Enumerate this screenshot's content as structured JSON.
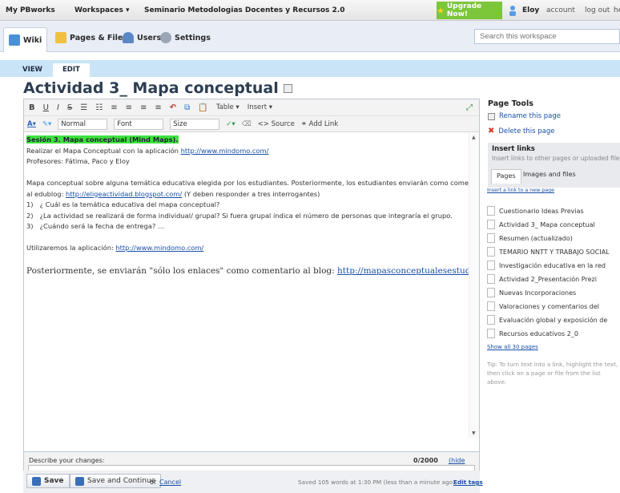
{
  "topbar": {
    "my_pbworks": "My PBworks",
    "workspaces": "Workspaces ▾",
    "workspace_name": "Seminario Metodologias Docentes y Recursos 2.0",
    "upgrade": "Upgrade Now!",
    "user": "Eloy",
    "account": "account",
    "logout": "log out",
    "help": "he"
  },
  "nav": {
    "tabs": [
      {
        "label": "Wiki"
      },
      {
        "label": "Pages & Files"
      },
      {
        "label": "Users"
      },
      {
        "label": "Settings"
      }
    ],
    "search_placeholder": "Search this workspace"
  },
  "subtabs": {
    "view": "VIEW",
    "edit": "EDIT"
  },
  "page_title": "Actividad 3_ Mapa conceptual",
  "toolbar": {
    "table": "Table ▾",
    "insert": "Insert ▾",
    "style": "Normal",
    "font": "Font",
    "size": "Size",
    "source": "Source",
    "add_link": "Add Link"
  },
  "content": {
    "line1": "Sesión 3. Mapa conceptual (Mind Maps).",
    "line2_text": "Realizar el Mapa Conceptual con la aplicación ",
    "line2_link": "http://www.mindomo.com/",
    "line3": "Profesores: Fátima, Paco y Eloy",
    "line4": "Mapa conceptual sobre alguna temática educativa elegida por los estudiantes. Posteriormente, los estudiantes enviarán como comentario (post)",
    "line5_pre": "al edublog: ",
    "line5_link": "http://eligeactividad.blogspot.com/",
    "line5_post": " (Y deben responder a tres interrogantes)",
    "list": [
      {
        "num": "1)",
        "text": "¿ Cuál es la temática educativa del mapa conceptual?"
      },
      {
        "num": "2)",
        "text": "¿La actividad se realizará de forma individual/ grupal? Si fuera grupal indica el número de personas que integraría el grupo."
      },
      {
        "num": "3)",
        "text": "¿Cuándo será la fecha de entrega? …"
      }
    ],
    "line6_pre": "Utilizaremos la aplicación: ",
    "line6_link": "http://www.mindomo.com/",
    "line7_pre": "Posteriormente, se enviarán \"sólo los enlaces\" como comentario al blog: ",
    "line7_link": "http://mapasconceptualesestudiantes.blogspot.com."
  },
  "describe": {
    "label": "Describe your changes:",
    "counter": "0/2000",
    "hide": "(hide this)"
  },
  "savebar": {
    "save": "Save",
    "save_continue": "Save and Continue",
    "or": "or",
    "cancel": "Cancel",
    "status": "Saved 105 words at 1:30 PM (less than a minute ago)",
    "edit_tags": "Edit tags"
  },
  "side": {
    "title": "Page Tools",
    "rename": "Rename this page",
    "delete": "Delete this page",
    "insert_links_title": "Insert links",
    "insert_links_desc": "Insert links to other pages or uploaded files.",
    "tab_pages": "Pages",
    "tab_images": "Images and files",
    "new_page_link": "Insert a link to a new page",
    "pages": [
      "Cuestionario Ideas Previas",
      "Actividad 3_ Mapa conceptual",
      "Resumen (actualizado)",
      "TEMARIO NNTT Y TRABAJO SOCIAL",
      "Investigación educativa en la red",
      "Actividad 2_Presentación Prezi",
      "Nuevas Incorporaciones",
      "Valoraciones y comentarios del",
      "Evaluación global y exposición de",
      "Recursos educativos 2_0"
    ],
    "show_all": "Show all 30 pages",
    "tip": "Tip: To turn text into a link, highlight the text, then click on a page or file from the list above."
  }
}
